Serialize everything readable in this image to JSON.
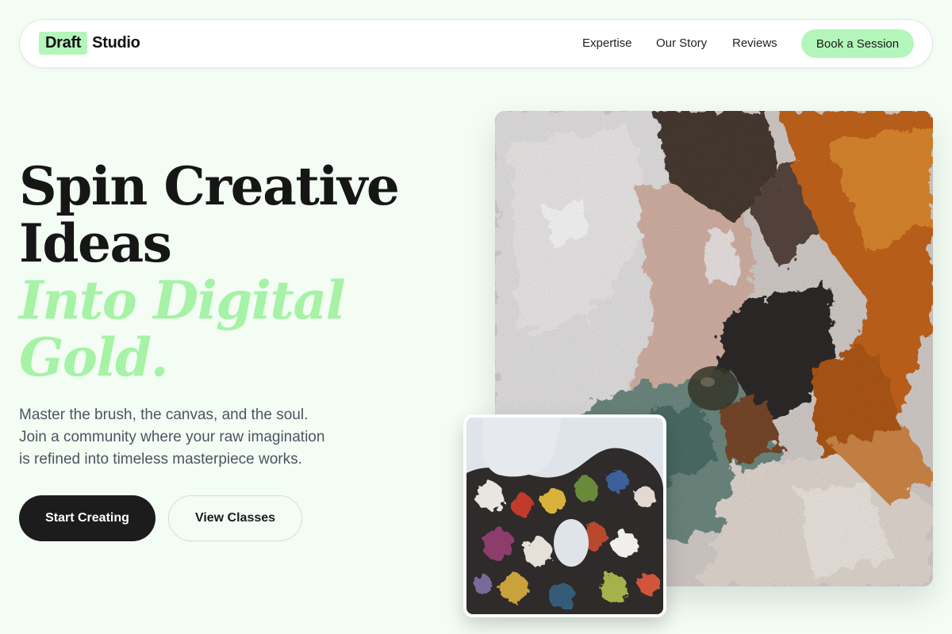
{
  "nav": {
    "logo_badge": "Draft",
    "logo_rest": "Studio",
    "links": [
      "Expertise",
      "Our Story",
      "Reviews"
    ],
    "cta": "Book a Session"
  },
  "hero": {
    "headline_lines": [
      "Spin Creative",
      "Ideas"
    ],
    "headline_accent_lines": [
      "Into Digital",
      "Gold."
    ],
    "subtitle_lines": [
      "Master the brush, the canvas, and the soul.",
      "Join a community where your raw imagination",
      "is refined into timeless masterpiece works."
    ],
    "primary_button": "Start Creating",
    "secondary_button": "View Classes"
  },
  "images": {
    "main": {
      "icon": "abstract-paint-texture-image"
    },
    "inset": {
      "icon": "paint-palette-image"
    }
  },
  "colors": {
    "accent": "#b4f5bb",
    "accent_text": "#a6f2a6",
    "background": "#f3fdf4",
    "dark": "#1c1c1c"
  }
}
